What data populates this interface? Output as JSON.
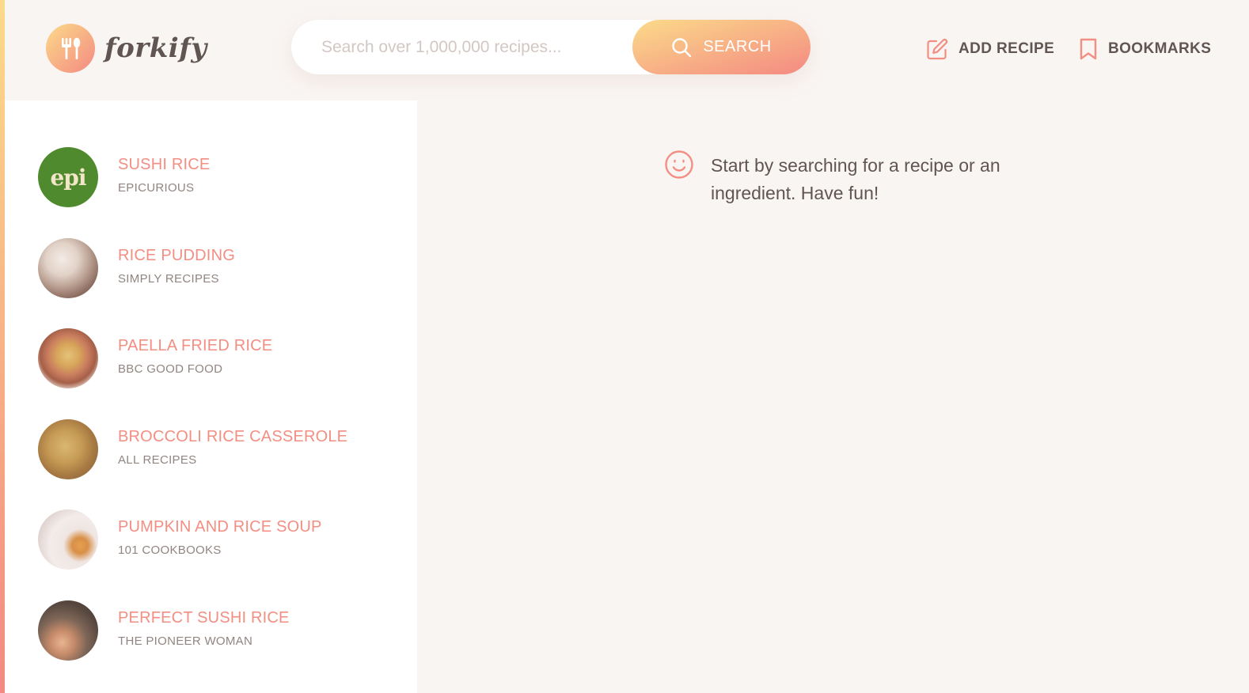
{
  "app": {
    "logo_text": "forkify"
  },
  "search": {
    "placeholder": "Search over 1,000,000 recipes...",
    "button_label": "SEARCH"
  },
  "nav": {
    "add_recipe": "ADD RECIPE",
    "bookmarks": "BOOKMARKS"
  },
  "results": [
    {
      "title": "SUSHI RICE",
      "publisher": "EPICURIOUS",
      "thumb": "epi-logo"
    },
    {
      "title": "RICE PUDDING",
      "publisher": "SIMPLY RECIPES",
      "thumb": "photo"
    },
    {
      "title": "PAELLA FRIED RICE",
      "publisher": "BBC GOOD FOOD",
      "thumb": "photo"
    },
    {
      "title": "BROCCOLI RICE CASSEROLE",
      "publisher": "ALL RECIPES",
      "thumb": "photo"
    },
    {
      "title": "PUMPKIN AND RICE SOUP",
      "publisher": "101 COOKBOOKS",
      "thumb": "photo"
    },
    {
      "title": "PERFECT SUSHI RICE",
      "publisher": "THE PIONEER WOMAN",
      "thumb": "photo"
    }
  ],
  "thumb_badge": "epi",
  "message": {
    "text": "Start by searching for a recipe or an ingredient. Have fun!"
  },
  "colors": {
    "accent": "#f38e82",
    "gradient_start": "#fbdb89",
    "gradient_end": "#f48982",
    "text": "#615551",
    "background": "#f9f5f3"
  },
  "icons": {
    "logo": "fork-spoon-icon",
    "search": "search-icon",
    "add_recipe": "edit-icon",
    "bookmarks": "bookmark-icon",
    "message": "smile-icon"
  }
}
